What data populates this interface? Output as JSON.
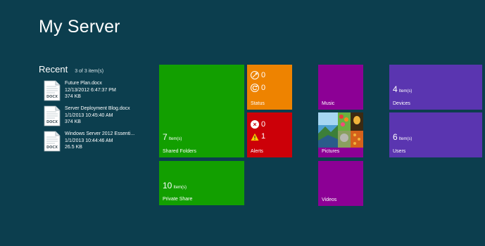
{
  "app": {
    "title": "My Server"
  },
  "recent": {
    "title": "Recent",
    "count": "3 of 3 item(s)",
    "items": [
      {
        "name": "Future Plan.docx",
        "date": "12/13/2012 6:47:37 PM",
        "size": "374 KB",
        "ext": "DOCX",
        "icon": "word-document-icon"
      },
      {
        "name": "Server Deployment Blog.docx",
        "date": "1/1/2013 10:45:40 AM",
        "size": "374 KB",
        "ext": "DOCX",
        "icon": "word-document-icon"
      },
      {
        "name": "Windows Server 2012 Essenti...",
        "date": "1/1/2013 10:44:46 AM",
        "size": "26.5 KB",
        "ext": "DOCX",
        "icon": "word-document-icon"
      }
    ]
  },
  "tiles": {
    "shared_folders": {
      "label": "Shared Folders",
      "count": "7",
      "unit": "Item(s)",
      "color": "#129f00"
    },
    "private_share": {
      "label": "Private Share",
      "count": "10",
      "unit": "Item(s)",
      "color": "#129f00"
    },
    "status": {
      "label": "Status",
      "row1": "0",
      "row2": "0",
      "color": "#ee8300",
      "icons": [
        "sync-tools-icon",
        "refresh-icon"
      ]
    },
    "alerts": {
      "label": "Alerts",
      "row1": "0",
      "row2": "1",
      "color": "#cc0008",
      "icons": [
        "error-icon",
        "warning-icon"
      ]
    },
    "music": {
      "label": "Music",
      "color": "#8c0095"
    },
    "pictures": {
      "label": "Pictures",
      "color": "#8c0095"
    },
    "videos": {
      "label": "Videos",
      "color": "#8c0095"
    },
    "devices": {
      "label": "Devices",
      "count": "4",
      "unit": "Item(s)",
      "color": "#5a35b0"
    },
    "users": {
      "label": "Users",
      "count": "6",
      "unit": "Item(s)",
      "color": "#5a35b0"
    }
  },
  "colors": {
    "background": "#0c3e4e"
  }
}
